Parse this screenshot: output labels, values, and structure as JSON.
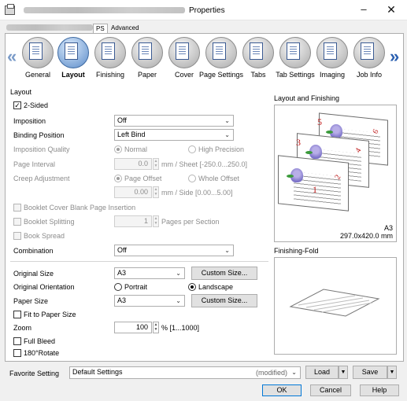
{
  "window": {
    "title": "Properties"
  },
  "top_tabs": [
    {
      "label": "PS",
      "selected": true
    },
    {
      "label": "Advanced",
      "selected": false
    }
  ],
  "icon_tabs": [
    {
      "label": "General"
    },
    {
      "label": "Layout",
      "selected": true
    },
    {
      "label": "Finishing"
    },
    {
      "label": "Paper"
    },
    {
      "label": "Cover"
    },
    {
      "label": "Page Settings"
    },
    {
      "label": "Tabs"
    },
    {
      "label": "Tab Settings"
    },
    {
      "label": "Imaging"
    },
    {
      "label": "Job Info"
    }
  ],
  "nav": {
    "prev": "«",
    "next": "»"
  },
  "layout": {
    "group_label": "Layout",
    "two_sided": {
      "label": "2-Sided",
      "checked": true
    },
    "imposition": {
      "label": "Imposition",
      "value": "Off"
    },
    "binding_position": {
      "label": "Binding Position",
      "value": "Left Bind"
    },
    "imposition_quality": {
      "label": "Imposition Quality",
      "normal": "Normal",
      "high": "High Precision",
      "selected": "Normal"
    },
    "page_interval": {
      "label": "Page Interval",
      "value": "0.0",
      "unit": "mm / Sheet [-250.0...250.0]"
    },
    "creep_adjustment": {
      "label": "Creep Adjustment",
      "page_offset": "Page Offset",
      "whole_offset": "Whole Offset",
      "selected": "Page Offset",
      "value": "0.00",
      "unit": "mm / Side [0.00...5.00]"
    },
    "booklet_cover": {
      "label": "Booklet Cover Blank Page Insertion",
      "checked": false
    },
    "booklet_splitting": {
      "label": "Booklet Splitting",
      "checked": false,
      "value": "1",
      "unit": "Pages per Section"
    },
    "book_spread": {
      "label": "Book Spread",
      "checked": false
    },
    "combination": {
      "label": "Combination",
      "value": "Off"
    }
  },
  "paper": {
    "original_size": {
      "label": "Original Size",
      "value": "A3",
      "button": "Custom Size..."
    },
    "original_orientation": {
      "label": "Original Orientation",
      "portrait": "Portrait",
      "landscape": "Landscape",
      "selected": "Landscape"
    },
    "paper_size": {
      "label": "Paper Size",
      "value": "A3",
      "button": "Custom Size..."
    },
    "fit_to_paper": {
      "label": "Fit to Paper Size",
      "checked": false
    },
    "zoom": {
      "label": "Zoom",
      "value": "100",
      "unit": "% [1...1000]"
    },
    "full_bleed": {
      "label": "Full Bleed",
      "checked": false
    },
    "rotate": {
      "label": "180°Rotate",
      "checked": false
    }
  },
  "preview": {
    "layout_finishing_label": "Layout and Finishing",
    "paper_name": "A3",
    "paper_dims": "297.0x420.0 mm",
    "page_numbers": [
      "1",
      "2",
      "3",
      "4",
      "5",
      "6"
    ],
    "finishing_fold_label": "Finishing-Fold"
  },
  "favorite": {
    "label": "Favorite Setting",
    "value": "Default Settings",
    "modified": "(modified)",
    "load": "Load",
    "save": "Save"
  },
  "dialog": {
    "ok": "OK",
    "cancel": "Cancel",
    "help": "Help"
  }
}
